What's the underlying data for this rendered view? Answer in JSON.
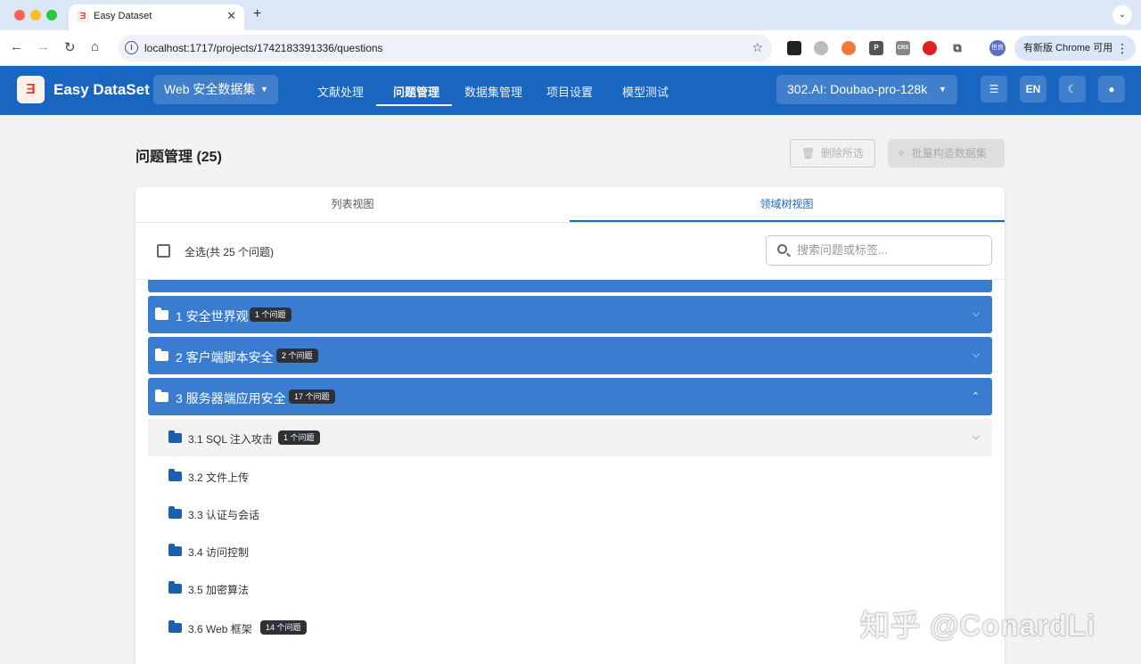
{
  "browser": {
    "tab_title": "Easy Dataset",
    "url": "localhost:1717/projects/1742183391336/questions",
    "update_button": "有新版 Chrome 可用",
    "profile_label": "世良",
    "ext_parking": "P",
    "ext_crx": "CRX"
  },
  "app": {
    "brand": "Easy DataSet",
    "project_select": "Web 安全数据集",
    "nav": [
      "文献处理",
      "问题管理",
      "数据集管理",
      "项目设置",
      "模型测试"
    ],
    "active_nav": "问题管理",
    "model_select": "302.AI: Doubao-pro-128k",
    "lang_button": "EN"
  },
  "page": {
    "title": "问题管理 (25)",
    "delete_button": "删除所选",
    "batch_button": "批量构造数据集",
    "view_tabs": [
      "列表视图",
      "领域树视图"
    ],
    "active_view": "领域树视图",
    "select_all": "全选(共 25 个问题)",
    "search_placeholder": "搜索问题或标签..."
  },
  "tree": {
    "groups": [
      {
        "label": "1 安全世界观",
        "badge": "1 个问题",
        "expanded": false
      },
      {
        "label": "2 客户端脚本安全",
        "badge": "2 个问题",
        "expanded": false
      },
      {
        "label": "3 服务器端应用安全",
        "badge": "17 个问题",
        "expanded": true
      }
    ],
    "children": [
      {
        "label": "3.1 SQL 注入攻击",
        "badge": "1 个问题"
      },
      {
        "label": "3.2 文件上传",
        "badge": ""
      },
      {
        "label": "3.3 认证与会话",
        "badge": ""
      },
      {
        "label": "3.4 访问控制",
        "badge": ""
      },
      {
        "label": "3.5 加密算法",
        "badge": ""
      },
      {
        "label": "3.6 Web 框架",
        "badge": "14 个问题"
      }
    ]
  },
  "watermark": "知乎 @ConardLi",
  "colors": {
    "primary": "#1966c0",
    "group_row": "#3a7cd0",
    "badge": "#2d3135"
  }
}
